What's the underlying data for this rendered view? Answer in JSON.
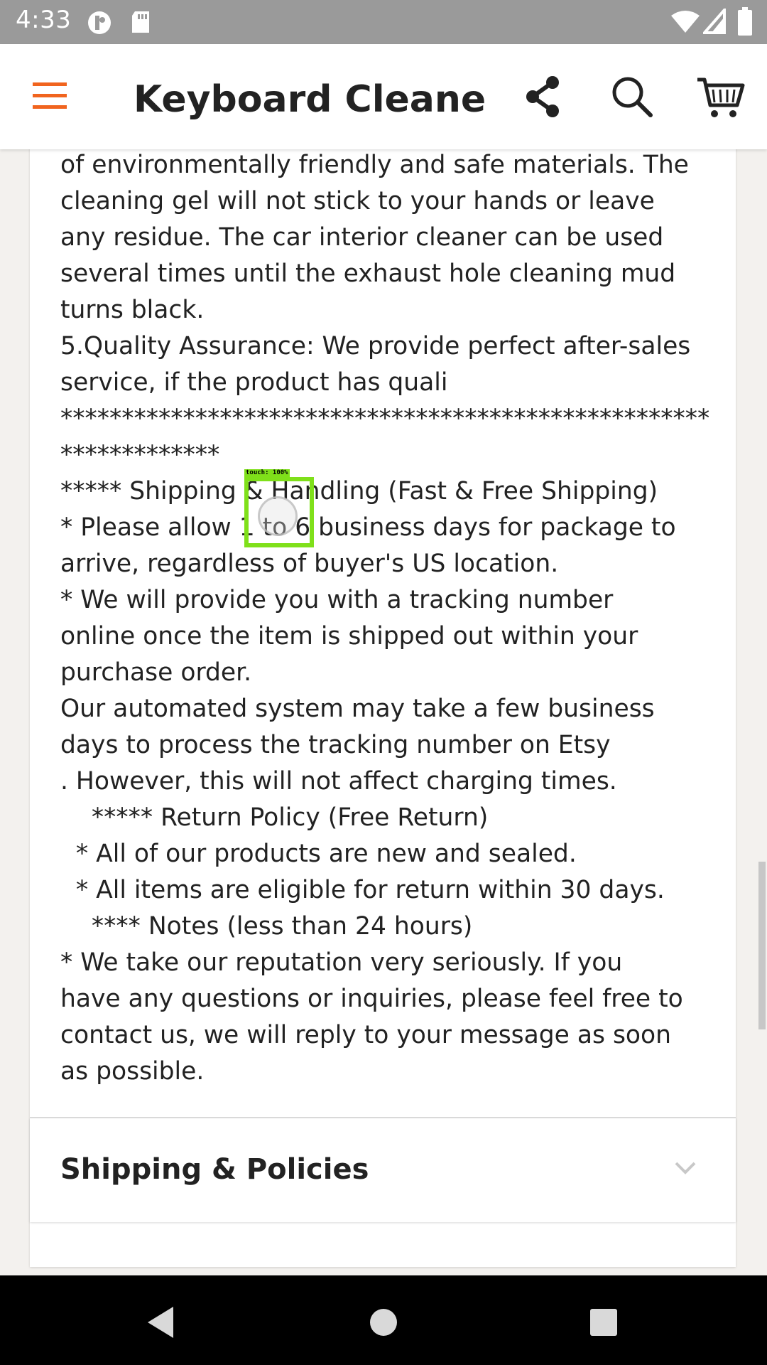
{
  "status_bar": {
    "time": "4:33",
    "icons": [
      "notification-circle-icon",
      "sd-card-icon",
      "wifi-icon",
      "signal-icon",
      "battery-icon"
    ]
  },
  "toolbar": {
    "title": "Keyboard Cleane...",
    "icons": [
      "menu-icon",
      "share-icon",
      "search-icon",
      "cart-icon"
    ],
    "accent_color": "#f1641e"
  },
  "description": {
    "lines": [
      "of environmentally friendly and safe materials. The",
      "cleaning gel will not stick to your hands or leave",
      "any residue. The car interior cleaner can be used",
      "several times until the exhaust hole cleaning mud",
      "turns black.",
      "5.Quality Assurance: We provide perfect after-sales",
      "service, if the product has quali",
      "*****************************************************",
      "*************",
      "***** Shipping & Handling (Fast & Free Shipping)",
      "* Please allow 1 to 6 business days for package to",
      "arrive, regardless of buyer's US location.",
      "* We will provide you with a tracking number",
      "online once the item is shipped out within your",
      "purchase order.",
      "Our automated system may take a few business",
      "days to process the tracking number on Etsy",
      ". However, this will not affect charging times.",
      "    ***** Return Policy (Free Return)",
      "  * All of our products are new and sealed.",
      "  * All items are eligible for return within 30 days.",
      "    **** Notes (less than 24 hours)",
      "* We take our reputation very seriously. If you",
      "have any questions or inquiries, please feel free to",
      "contact us, we will reply to your message as soon",
      "as possible."
    ]
  },
  "policies": {
    "label": "Shipping & Policies"
  },
  "touch_indicator": {
    "label": "touch: 100%"
  },
  "nav_bar": {
    "icons": [
      "back-icon",
      "home-icon",
      "recents-icon"
    ]
  }
}
